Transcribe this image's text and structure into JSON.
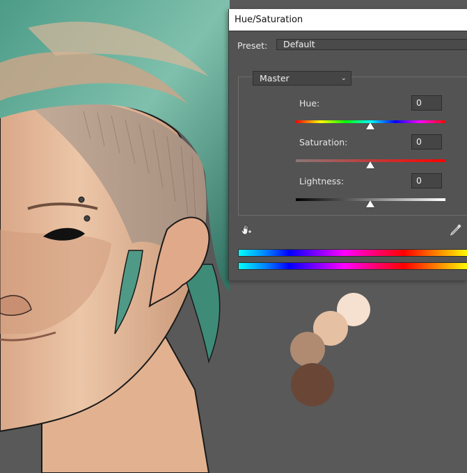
{
  "dialog": {
    "title": "Hue/Saturation",
    "preset_label": "Preset:",
    "preset_value": "Default",
    "channel": "Master",
    "sliders": [
      {
        "label": "Hue:",
        "value": "0"
      },
      {
        "label": "Saturation:",
        "value": "0"
      },
      {
        "label": "Lightness:",
        "value": "0"
      }
    ]
  },
  "icons": {
    "targeted_adjustment": "hand-icon",
    "eyedropper": "eyedropper-icon",
    "dropdown": "chevron-down-icon"
  },
  "swatches": [
    "#f6e0cf",
    "#e6c0a3",
    "#b08b72",
    "#6a4636"
  ],
  "colors": {
    "background": "#595959",
    "hair": "#5fa894",
    "skin": "#e8bc9a"
  }
}
